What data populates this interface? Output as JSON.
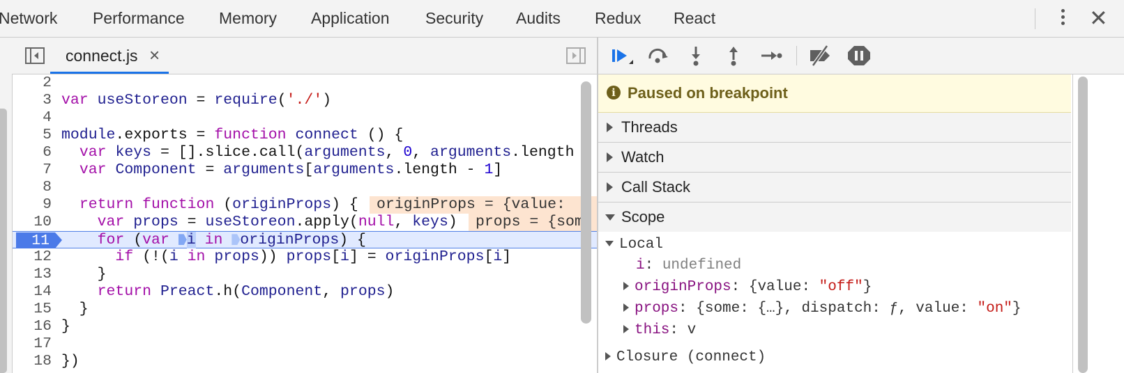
{
  "panel_tabs": [
    "Network",
    "Performance",
    "Memory",
    "Application",
    "Security",
    "Audits",
    "Redux",
    "React"
  ],
  "editor": {
    "file_tab": "connect.js",
    "file_close": "×",
    "lines": [
      {
        "n": "2",
        "code": ""
      },
      {
        "n": "3",
        "code": "var useStoreon = require('./')"
      },
      {
        "n": "4",
        "code": ""
      },
      {
        "n": "5",
        "code": "module.exports = function connect () {"
      },
      {
        "n": "6",
        "code": "  var keys = [].slice.call(arguments, 0, arguments.length"
      },
      {
        "n": "7",
        "code": "  var Component = arguments[arguments.length - 1]"
      },
      {
        "n": "8",
        "code": ""
      },
      {
        "n": "9",
        "code": "  return function (originProps) {"
      },
      {
        "n": "10",
        "code": "    var props = useStoreon.apply(null, keys)"
      },
      {
        "n": "11",
        "code": "    for (var i in originProps) {"
      },
      {
        "n": "12",
        "code": "      if (!(i in props)) props[i] = originProps[i]"
      },
      {
        "n": "13",
        "code": "    }"
      },
      {
        "n": "14",
        "code": "    return Preact.h(Component, props)"
      },
      {
        "n": "15",
        "code": "  }"
      },
      {
        "n": "16",
        "code": "}"
      },
      {
        "n": "17",
        "code": ""
      },
      {
        "n": "18",
        "code": "})"
      }
    ],
    "inline_values": {
      "line9": "originProps = {value:",
      "line10": "props = {som"
    },
    "current_line": "11"
  },
  "debugger": {
    "paused_message": "Paused on breakpoint",
    "sections": [
      "Threads",
      "Watch",
      "Call Stack",
      "Scope"
    ],
    "scope": {
      "local_label": "Local",
      "i_name": "i",
      "i_value": "undefined",
      "originProps_name": "originProps",
      "originProps_open": "{value: ",
      "originProps_str": "\"off\"",
      "originProps_close": "}",
      "props_name": "props",
      "props_value": "{some: {…}, dispatch: ƒ, value: ",
      "props_str": "\"on\"",
      "props_close": "}",
      "this_name": "this",
      "this_value": "v",
      "closure_label": "Closure (connect)"
    }
  },
  "colors": {
    "accent": "#1a73e8",
    "breakpoint": "#4b7ae8",
    "paused_bg": "#fffbe0",
    "paused_text": "#6d5f1a"
  }
}
